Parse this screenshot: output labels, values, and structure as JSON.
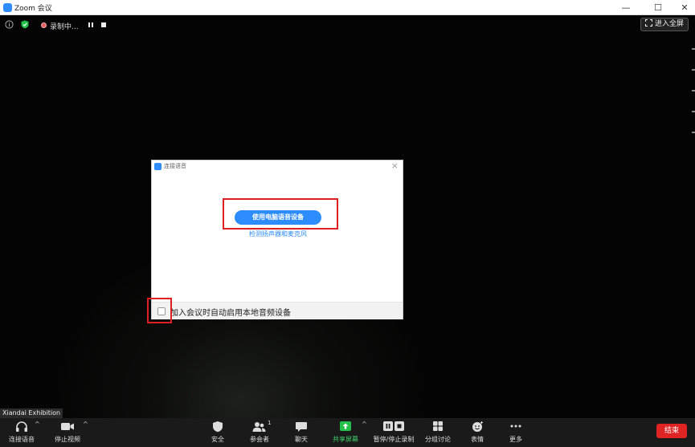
{
  "window": {
    "title": "Zoom 会议",
    "minimize": "—",
    "maximize": "☐",
    "close": "✕"
  },
  "meeting_topbar": {
    "recording_label": "录制中...",
    "fullscreen_label": "进入全屏"
  },
  "dialog": {
    "title": "连接语音",
    "primary_button": "使用电脑语音设备",
    "test_link": "检测扬声器和麦克风",
    "auto_join_checkbox_label": "加入会议时自动启用本地音频设备",
    "auto_join_checked": false
  },
  "participant_name": "Xiandai Exhibition",
  "toolbar": {
    "audio": "连接语音",
    "video": "停止视频",
    "security": "安全",
    "participants": "参会者",
    "participants_count": "1",
    "chat": "聊天",
    "share": "共享屏幕",
    "record": "暂停/停止录制",
    "breakout": "分组讨论",
    "reactions": "表情",
    "more": "更多",
    "end": "结束"
  },
  "colors": {
    "zoom_blue": "#2d8cff",
    "share_green": "#23c14a",
    "end_red": "#e02424",
    "highlight_red": "#e02020"
  }
}
